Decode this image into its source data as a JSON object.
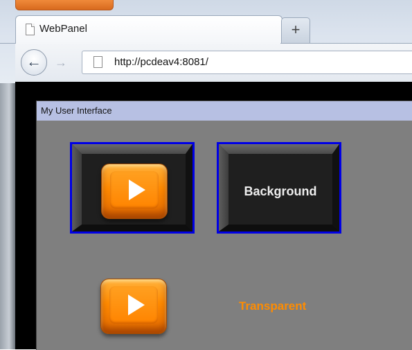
{
  "browser": {
    "tab_title": "WebPanel",
    "new_tab_symbol": "+",
    "url": "http://pcdeav4:8081/",
    "back_symbol": "←",
    "forward_symbol": "→"
  },
  "window": {
    "title": "My User Interface"
  },
  "tiles": {
    "background_label": "Background",
    "transparent_label": "Transparent"
  },
  "icons": {
    "tab": "page-icon",
    "url": "page-icon",
    "play": "play-icon"
  },
  "colors": {
    "tile_border": "#0000e6",
    "window_titlebar": "#b7c0e3",
    "panel_background": "#7f7f7f",
    "accent_orange": "#ff8c00"
  }
}
